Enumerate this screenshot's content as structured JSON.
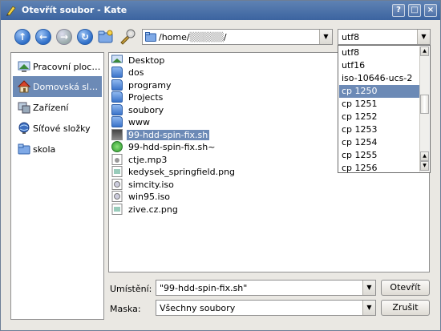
{
  "window": {
    "title": "Otevřít soubor - Kate",
    "buttons": [
      "?",
      "□",
      "×"
    ]
  },
  "toolbar": {
    "path_value": "/home/",
    "path_masked": "▒▒▒▒▒",
    "path_suffix": "/",
    "encoding_value": "utf8",
    "icons": [
      "arrow-up-icon",
      "arrow-back-icon",
      "arrow-forward-icon",
      "reload-icon",
      "new-folder-icon",
      "settings-icon"
    ]
  },
  "sidebar": {
    "items": [
      {
        "label": "Pracovní ploc…",
        "icon": "desktop-icon"
      },
      {
        "label": "Domovská sl…",
        "icon": "home-icon",
        "selected": true
      },
      {
        "label": "Zařízení",
        "icon": "devices-icon"
      },
      {
        "label": "Síťové složky",
        "icon": "network-icon"
      },
      {
        "label": "skola",
        "icon": "folder-icon"
      }
    ]
  },
  "files": [
    {
      "name": "Desktop",
      "type": "folder"
    },
    {
      "name": "dos",
      "type": "folder"
    },
    {
      "name": "programy",
      "type": "folder"
    },
    {
      "name": "Projects",
      "type": "folder"
    },
    {
      "name": "soubory",
      "type": "folder"
    },
    {
      "name": "www",
      "type": "folder"
    },
    {
      "name": "99-hdd-spin-fix.sh",
      "type": "script",
      "selected": true
    },
    {
      "name": "99-hdd-spin-fix.sh~",
      "type": "backup"
    },
    {
      "name": "ctje.mp3",
      "type": "audio"
    },
    {
      "name": "kedysek_springfield.png",
      "type": "image"
    },
    {
      "name": "simcity.iso",
      "type": "disc"
    },
    {
      "name": "win95.iso",
      "type": "disc"
    },
    {
      "name": "zive.cz.png",
      "type": "image"
    }
  ],
  "encoding_dropdown": {
    "items": [
      "utf8",
      "utf16",
      "iso-10646-ucs-2",
      "cp 1250",
      "cp 1251",
      "cp 1252",
      "cp 1253",
      "cp 1254",
      "cp 1255",
      "cp 1256"
    ],
    "selected_index": 3
  },
  "bottom": {
    "location_label": "Umístění:",
    "location_value": "\"99-hdd-spin-fix.sh\"",
    "filter_label": "Maska:",
    "filter_value": "Všechny soubory",
    "open_button": "Otevřít",
    "cancel_button": "Zrušit"
  }
}
